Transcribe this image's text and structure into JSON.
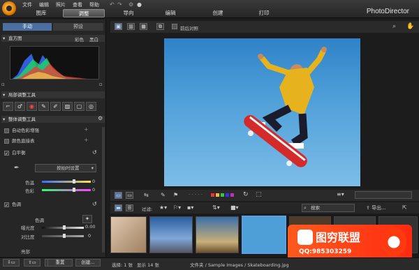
{
  "menu": [
    "文件",
    "编辑",
    "照片",
    "查看",
    "帮助"
  ],
  "modes": [
    "图库",
    "调整",
    "导向",
    "编辑",
    "创建",
    "打印"
  ],
  "active_mode": "调整",
  "brand": "PhotoDirector",
  "left": {
    "tabs": [
      "手动",
      "预设"
    ],
    "histogram": {
      "title": "直方图",
      "opt1": "彩色",
      "opt2": "黑白"
    },
    "local_tools": "局部调整工具",
    "global_tools": "整体调整工具",
    "auto_tone": "自动色彩增强",
    "color_picker": "颜色直接表",
    "white_balance": "白平衡",
    "wb_preset": "按拍时设置",
    "temp": "色温",
    "tint": "色彩",
    "tone": "色调",
    "tone_label": "色调",
    "exposure": "曝光度",
    "exposure_val": "0.00",
    "contrast": "对比度",
    "contrast_val": "0",
    "highlight": "亮部",
    "temp_val": "0",
    "tint_val": "0"
  },
  "toolbar": {
    "compare": "前后对照"
  },
  "filters": {
    "label": "过滤:",
    "search": "搜索",
    "import": "导出..."
  },
  "bottom": {
    "btn1": "重置",
    "btn2": "创建..."
  },
  "status": {
    "selected": "选择: 1 张",
    "shown": "显示 14 张",
    "path": "文件夹 / Sample Images / Skateboarding.jpg"
  },
  "ad": {
    "title": "图穷联盟",
    "qq": "QQ:985303259"
  },
  "colors": {
    "accent": "#4aa0e0",
    "photo_sky": "#4e9fd8"
  }
}
